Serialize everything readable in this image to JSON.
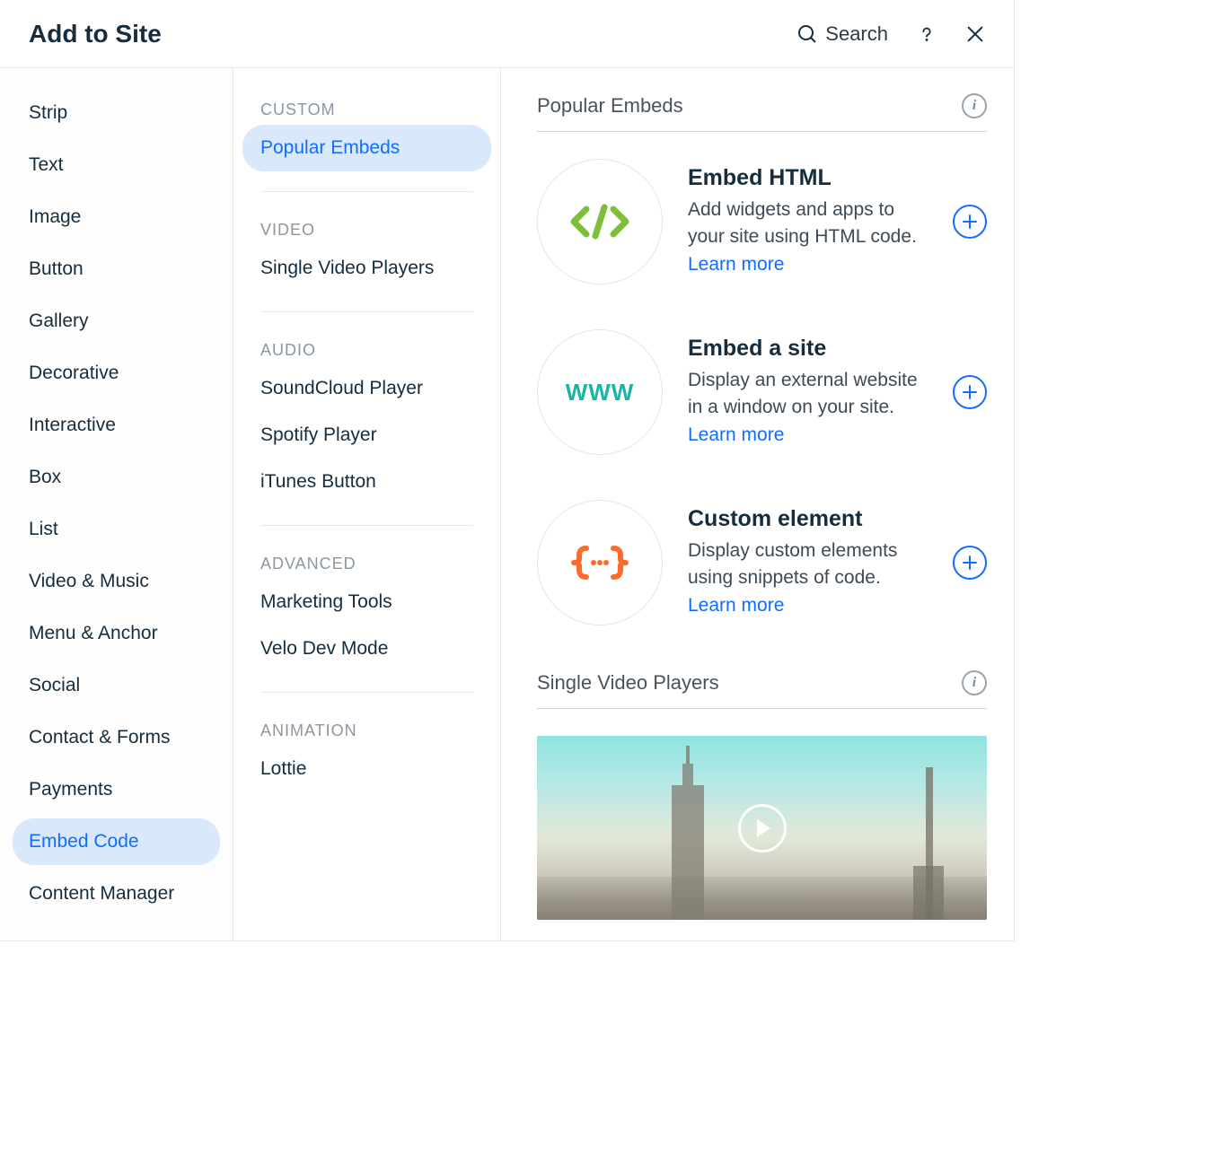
{
  "header": {
    "title": "Add to Site",
    "search_label": "Search"
  },
  "sidebar": {
    "items": [
      {
        "label": "Strip",
        "active": false
      },
      {
        "label": "Text",
        "active": false
      },
      {
        "label": "Image",
        "active": false
      },
      {
        "label": "Button",
        "active": false
      },
      {
        "label": "Gallery",
        "active": false
      },
      {
        "label": "Decorative",
        "active": false
      },
      {
        "label": "Interactive",
        "active": false
      },
      {
        "label": "Box",
        "active": false
      },
      {
        "label": "List",
        "active": false
      },
      {
        "label": "Video & Music",
        "active": false
      },
      {
        "label": "Menu & Anchor",
        "active": false
      },
      {
        "label": "Social",
        "active": false
      },
      {
        "label": "Contact & Forms",
        "active": false
      },
      {
        "label": "Payments",
        "active": false
      },
      {
        "label": "Embed Code",
        "active": true
      },
      {
        "label": "Content Manager",
        "active": false
      }
    ]
  },
  "subnav": {
    "groups": [
      {
        "header": "CUSTOM",
        "items": [
          {
            "label": "Popular Embeds",
            "active": true
          }
        ]
      },
      {
        "header": "VIDEO",
        "items": [
          {
            "label": "Single Video Players",
            "active": false
          }
        ]
      },
      {
        "header": "AUDIO",
        "items": [
          {
            "label": "SoundCloud Player",
            "active": false
          },
          {
            "label": "Spotify Player",
            "active": false
          },
          {
            "label": "iTunes Button",
            "active": false
          }
        ]
      },
      {
        "header": "ADVANCED",
        "items": [
          {
            "label": "Marketing Tools",
            "active": false
          },
          {
            "label": "Velo Dev Mode",
            "active": false
          }
        ]
      },
      {
        "header": "ANIMATION",
        "items": [
          {
            "label": "Lottie",
            "active": false
          }
        ]
      }
    ]
  },
  "content": {
    "section1_title": "Popular Embeds",
    "section2_title": "Single Video Players",
    "learn_more": "Learn more",
    "embeds": [
      {
        "title": "Embed HTML",
        "desc": "Add widgets and apps to your site using HTML code.",
        "icon": "code"
      },
      {
        "title": "Embed a site",
        "desc": "Display an external website in a window on your site.",
        "icon": "www"
      },
      {
        "title": "Custom element",
        "desc": "Display custom elements using snippets of code.",
        "icon": "braces"
      }
    ]
  }
}
